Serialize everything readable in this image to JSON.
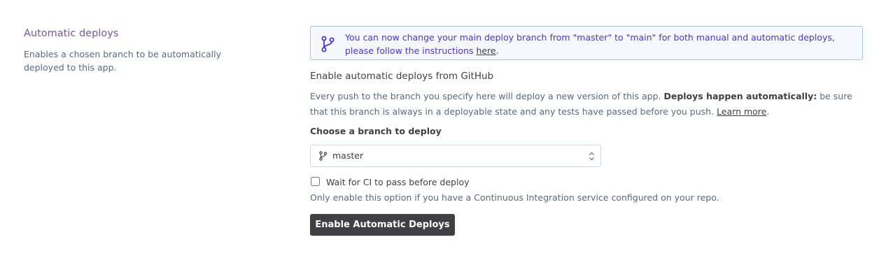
{
  "section": {
    "title": "Automatic deploys",
    "description": "Enables a chosen branch to be automatically deployed to this app."
  },
  "notice": {
    "icon": "git-branch-icon",
    "text": "You can now change your main deploy branch from \"master\" to \"main\" for both manual and automatic deploys, please follow the instructions ",
    "link_label": "here",
    "suffix": "."
  },
  "github": {
    "heading": "Enable automatic deploys from GitHub",
    "explain_prefix": "Every push to the branch you specify here will deploy a new version of this app. ",
    "explain_bold": "Deploys happen automatically:",
    "explain_suffix": " be sure that this branch is always in a deployable state and any tests have passed before you push. ",
    "learn_more": "Learn more",
    "learn_more_suffix": "."
  },
  "branch_select": {
    "label": "Choose a branch to deploy",
    "value": "master",
    "icon": "git-branch-icon"
  },
  "ci": {
    "checked": false,
    "label": "Wait for CI to pass before deploy",
    "help": "Only enable this option if you have a Continuous Integration service configured on your repo."
  },
  "actions": {
    "enable_label": "Enable Automatic Deploys"
  },
  "colors": {
    "accent_purple": "#79589f",
    "notice_text": "#4c33d6",
    "notice_bg": "#f5f9ff",
    "notice_border": "#a7c2e8",
    "button_bg": "#3f3f44"
  }
}
